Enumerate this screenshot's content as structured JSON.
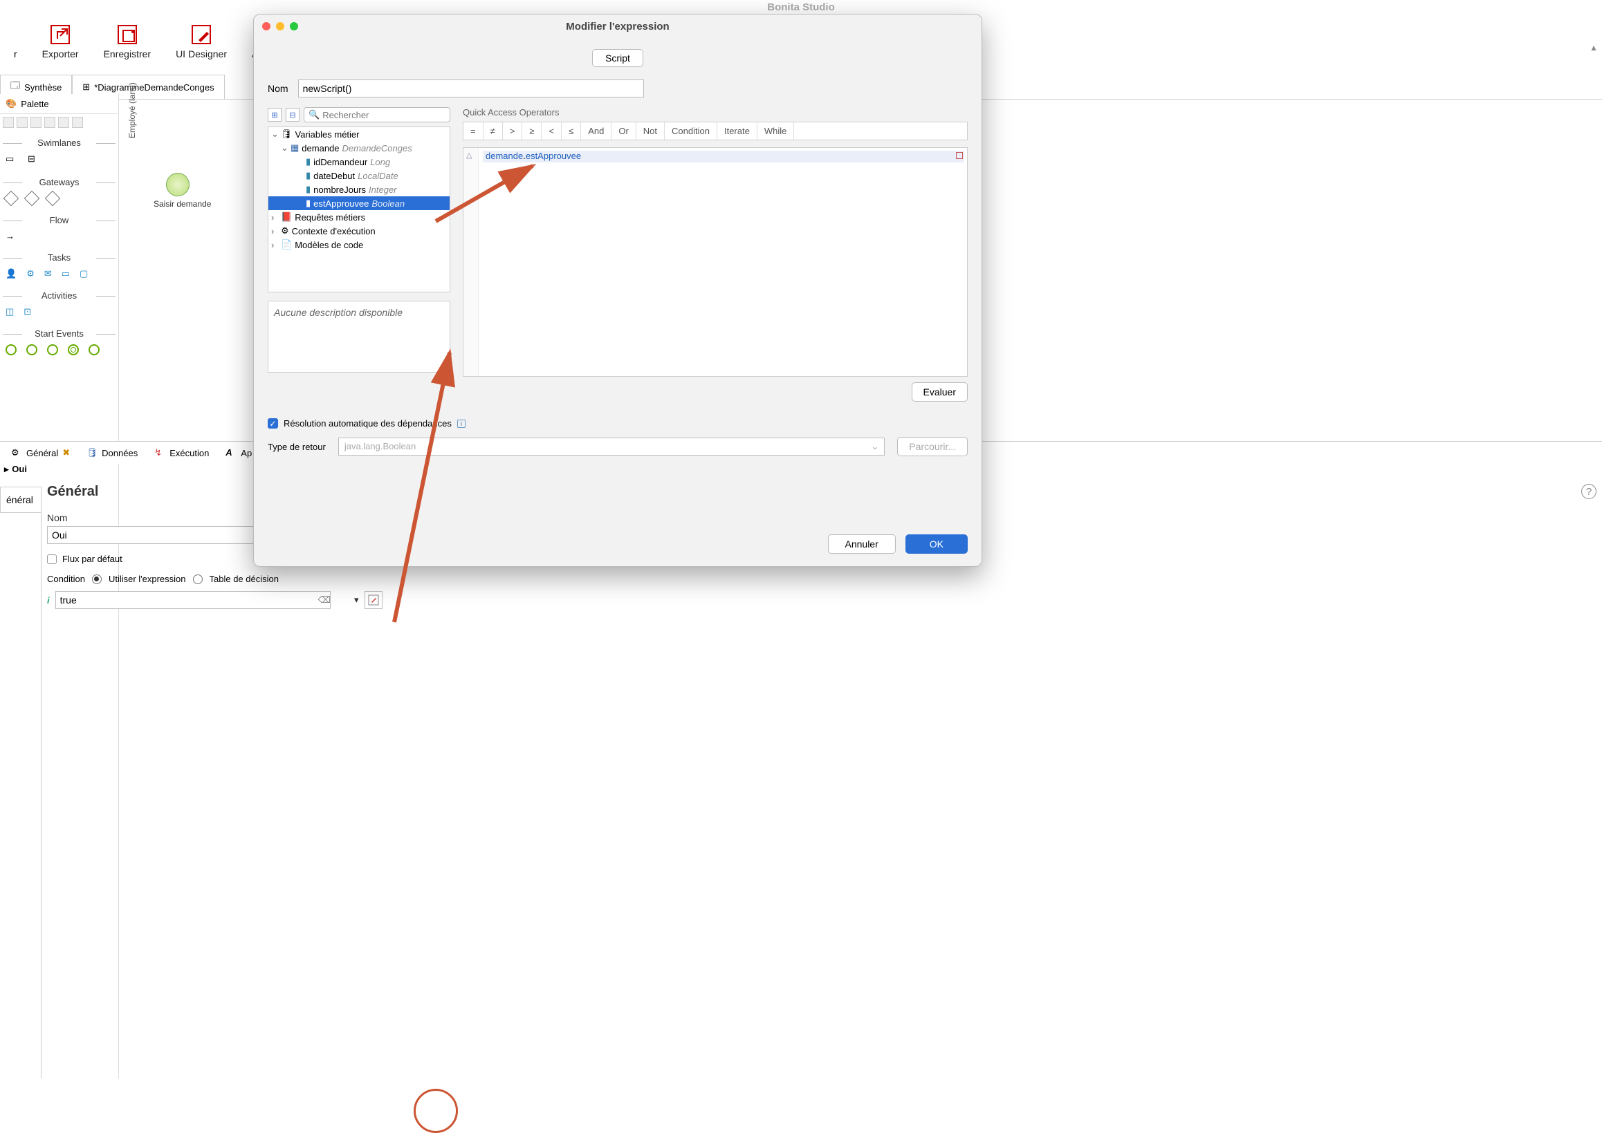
{
  "app": {
    "title": "Bonita Studio"
  },
  "toolbar": {
    "export": "Exporter",
    "save": "Enregistrer",
    "uidesigner": "UI Designer",
    "applications": "Applicati"
  },
  "editor_tabs": {
    "synthese": "Synthèse",
    "diagram": "*DiagrammeDemandeConges"
  },
  "palette": {
    "title": "Palette",
    "sections": {
      "swimlanes": "Swimlanes",
      "gateways": "Gateways",
      "flow": "Flow",
      "tasks": "Tasks",
      "activities": "Activities",
      "start_events": "Start Events"
    }
  },
  "canvas": {
    "lane": "Employé (lane)",
    "task": "Saisir demande"
  },
  "bottom_tabs": {
    "general": "Général",
    "data": "Données",
    "execution": "Exécution",
    "apparence": "Ap"
  },
  "properties": {
    "crumb_symbol": "▸",
    "crumb_label": "Oui",
    "side_tab": "énéral",
    "title": "Général",
    "nom_label": "Nom",
    "nom_value": "Oui",
    "flux_defaut": "Flux par défaut",
    "condition_label": "Condition",
    "use_expression": "Utiliser l'expression",
    "decision_table": "Table de décision",
    "expr_value": "true"
  },
  "dialog": {
    "title": "Modifier l'expression",
    "script_tab": "Script",
    "nom_label": "Nom",
    "nom_value": "newScript()",
    "search_placeholder": "Rechercher",
    "tree": {
      "business_vars": "Variables métier",
      "demande": "demande",
      "demande_type": "DemandeConges",
      "idDemandeur": "idDemandeur",
      "idDemandeur_t": "Long",
      "dateDebut": "dateDebut",
      "dateDebut_t": "LocalDate",
      "nombreJours": "nombreJours",
      "nombreJours_t": "Integer",
      "estApprouvee": "estApprouvee",
      "estApprouvee_t": "Boolean",
      "requetes": "Requêtes métiers",
      "contexte": "Contexte d'exécution",
      "modeles": "Modèles de code"
    },
    "description_empty": "Aucune description disponible",
    "qao_label": "Quick Access Operators",
    "ops": [
      "=",
      "≠",
      ">",
      "≥",
      "<",
      "≤",
      "And",
      "Or",
      "Not",
      "Condition",
      "Iterate",
      "While"
    ],
    "code_var": "demande",
    "code_dot": ".",
    "code_field": "estApprouvee",
    "evaluate": "Evaluer",
    "auto_deps": "Résolution automatique des dépendances",
    "return_label": "Type de retour",
    "return_value": "java.lang.Boolean",
    "browse": "Parcourir...",
    "cancel": "Annuler",
    "ok": "OK"
  }
}
